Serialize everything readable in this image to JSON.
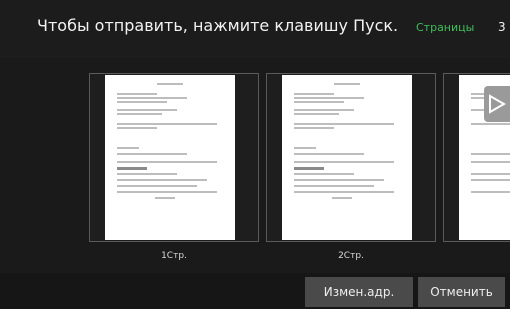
{
  "header": {
    "message": "Чтобы отправить, нажмите клавишу Пуск.",
    "pages_label": "Страницы",
    "pages_count": "3"
  },
  "thumbnails": [
    {
      "label": "1Стр."
    },
    {
      "label": "2Стр."
    },
    {
      "label": ""
    }
  ],
  "icons": {
    "next": "play-arrow-icon"
  },
  "footer": {
    "change_address": "Измен.адр.",
    "cancel": "Отменить"
  },
  "colors": {
    "background": "#161616",
    "accent_green": "#3fbf5a",
    "button": "#4a4a4a"
  }
}
